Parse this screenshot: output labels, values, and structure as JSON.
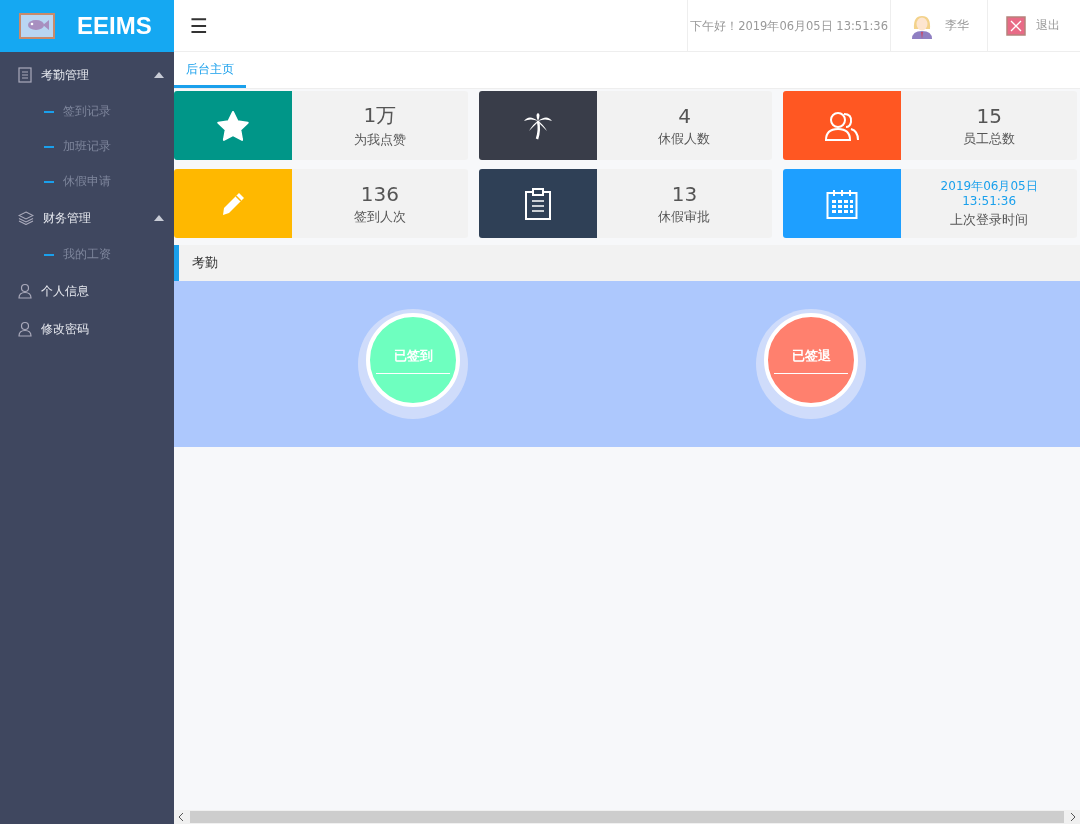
{
  "brand": {
    "name": "EEIMS"
  },
  "header": {
    "menu_glyph": "☰",
    "greeting": "下午好！2019年06月05日 13:51:36",
    "user": "李华",
    "logout": "退出"
  },
  "sidebar": {
    "items": [
      {
        "label": "考勤管理",
        "expanded": true,
        "children": [
          {
            "label": "签到记录"
          },
          {
            "label": "加班记录"
          },
          {
            "label": "休假申请"
          }
        ]
      },
      {
        "label": "财务管理",
        "expanded": true,
        "children": [
          {
            "label": "我的工资"
          }
        ]
      },
      {
        "label": "个人信息"
      },
      {
        "label": "修改密码"
      }
    ]
  },
  "tabs": [
    {
      "label": "后台主页",
      "selected": true
    }
  ],
  "stats": [
    {
      "kind": "number",
      "value": "1万",
      "label": "为我点赞",
      "color": "#009688"
    },
    {
      "kind": "number",
      "value": "4",
      "label": "休假人数",
      "color": "#393d49"
    },
    {
      "kind": "number",
      "value": "15",
      "label": "员工总数",
      "color": "#ff5722"
    },
    {
      "kind": "number",
      "value": "136",
      "label": "签到人次",
      "color": "#ffb800"
    },
    {
      "kind": "number",
      "value": "13",
      "label": "休假审批",
      "color": "#2f4056"
    },
    {
      "kind": "datetime",
      "value_lines": [
        "2019年06月05日",
        "13:51:36"
      ],
      "label": "上次登录时间",
      "color": "#1e9fff"
    }
  ],
  "attendance": {
    "title": "考勤",
    "buttons": [
      {
        "label": "已签到",
        "color": "#6effbf"
      },
      {
        "label": "已签退",
        "color": "#ff806e"
      }
    ]
  }
}
